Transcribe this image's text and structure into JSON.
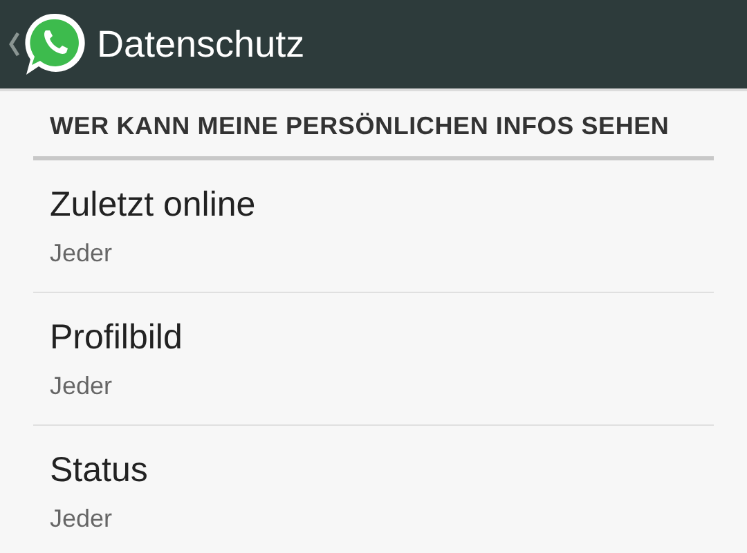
{
  "app_bar": {
    "title": "Datenschutz"
  },
  "section": {
    "title": "WER KANN MEINE PERSÖNLICHEN INFOS SEHEN"
  },
  "settings": [
    {
      "label": "Zuletzt online",
      "value": "Jeder"
    },
    {
      "label": "Profilbild",
      "value": "Jeder"
    },
    {
      "label": "Status",
      "value": "Jeder"
    }
  ]
}
